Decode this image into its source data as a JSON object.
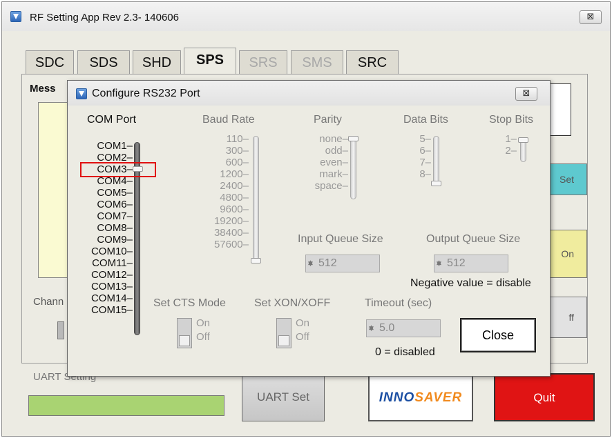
{
  "main_window": {
    "title": "RF Setting App Rev 2.3- 140606",
    "close_symbol": "⊠",
    "tabs": [
      {
        "label": "SDC",
        "state": "normal"
      },
      {
        "label": "SDS",
        "state": "normal"
      },
      {
        "label": "SHD",
        "state": "normal"
      },
      {
        "label": "SPS",
        "state": "active"
      },
      {
        "label": "SRS",
        "state": "disabled"
      },
      {
        "label": "SMS",
        "state": "disabled"
      },
      {
        "label": "SRC",
        "state": "normal"
      }
    ],
    "message_label": "Mess",
    "channel_label": "Chann",
    "side_buttons": [
      {
        "label": "Set",
        "color": "#5ec9cf"
      },
      {
        "label": "On",
        "color": "#f0ec9e"
      },
      {
        "label": "ff",
        "color": "#e2e2e2"
      }
    ],
    "uart_label": "UART Setting",
    "uart_progress_percent": 100,
    "uart_set_button": "UART Set",
    "logo_text_part1": "INNO",
    "logo_text_part2": "SAVER",
    "quit_button": "Quit"
  },
  "dialog": {
    "title": "Configure RS232 Port",
    "close_symbol": "⊠",
    "com_port": {
      "heading": "COM Port",
      "options": [
        "COM1",
        "COM2",
        "COM3",
        "COM4",
        "COM5",
        "COM6",
        "COM7",
        "COM8",
        "COM9",
        "COM10",
        "COM11",
        "COM12",
        "COM13",
        "COM14",
        "COM15"
      ],
      "selected": "COM3"
    },
    "baud_rate": {
      "heading": "Baud Rate",
      "options": [
        "110",
        "300",
        "600",
        "1200",
        "2400",
        "4800",
        "9600",
        "19200",
        "38400",
        "57600"
      ],
      "selected": "57600"
    },
    "parity": {
      "heading": "Parity",
      "options": [
        "none",
        "odd",
        "even",
        "mark",
        "space"
      ],
      "selected": "none"
    },
    "data_bits": {
      "heading": "Data Bits",
      "options": [
        "5",
        "6",
        "7",
        "8"
      ],
      "selected": "8"
    },
    "stop_bits": {
      "heading": "Stop Bits",
      "options": [
        "1",
        "2"
      ],
      "selected": "1"
    },
    "input_queue": {
      "label": "Input Queue Size",
      "value": "512"
    },
    "output_queue": {
      "label": "Output Queue Size",
      "value": "512"
    },
    "negative_note": "Negative value = disable",
    "cts": {
      "label": "Set CTS Mode",
      "on": "On",
      "off": "Off"
    },
    "xon": {
      "label": "Set XON/XOFF",
      "on": "On",
      "off": "Off"
    },
    "timeout": {
      "label": "Timeout (sec)",
      "value": "5.0",
      "note": "0 = disabled"
    },
    "close_button": "Close",
    "highlight_color": "#e01010"
  }
}
